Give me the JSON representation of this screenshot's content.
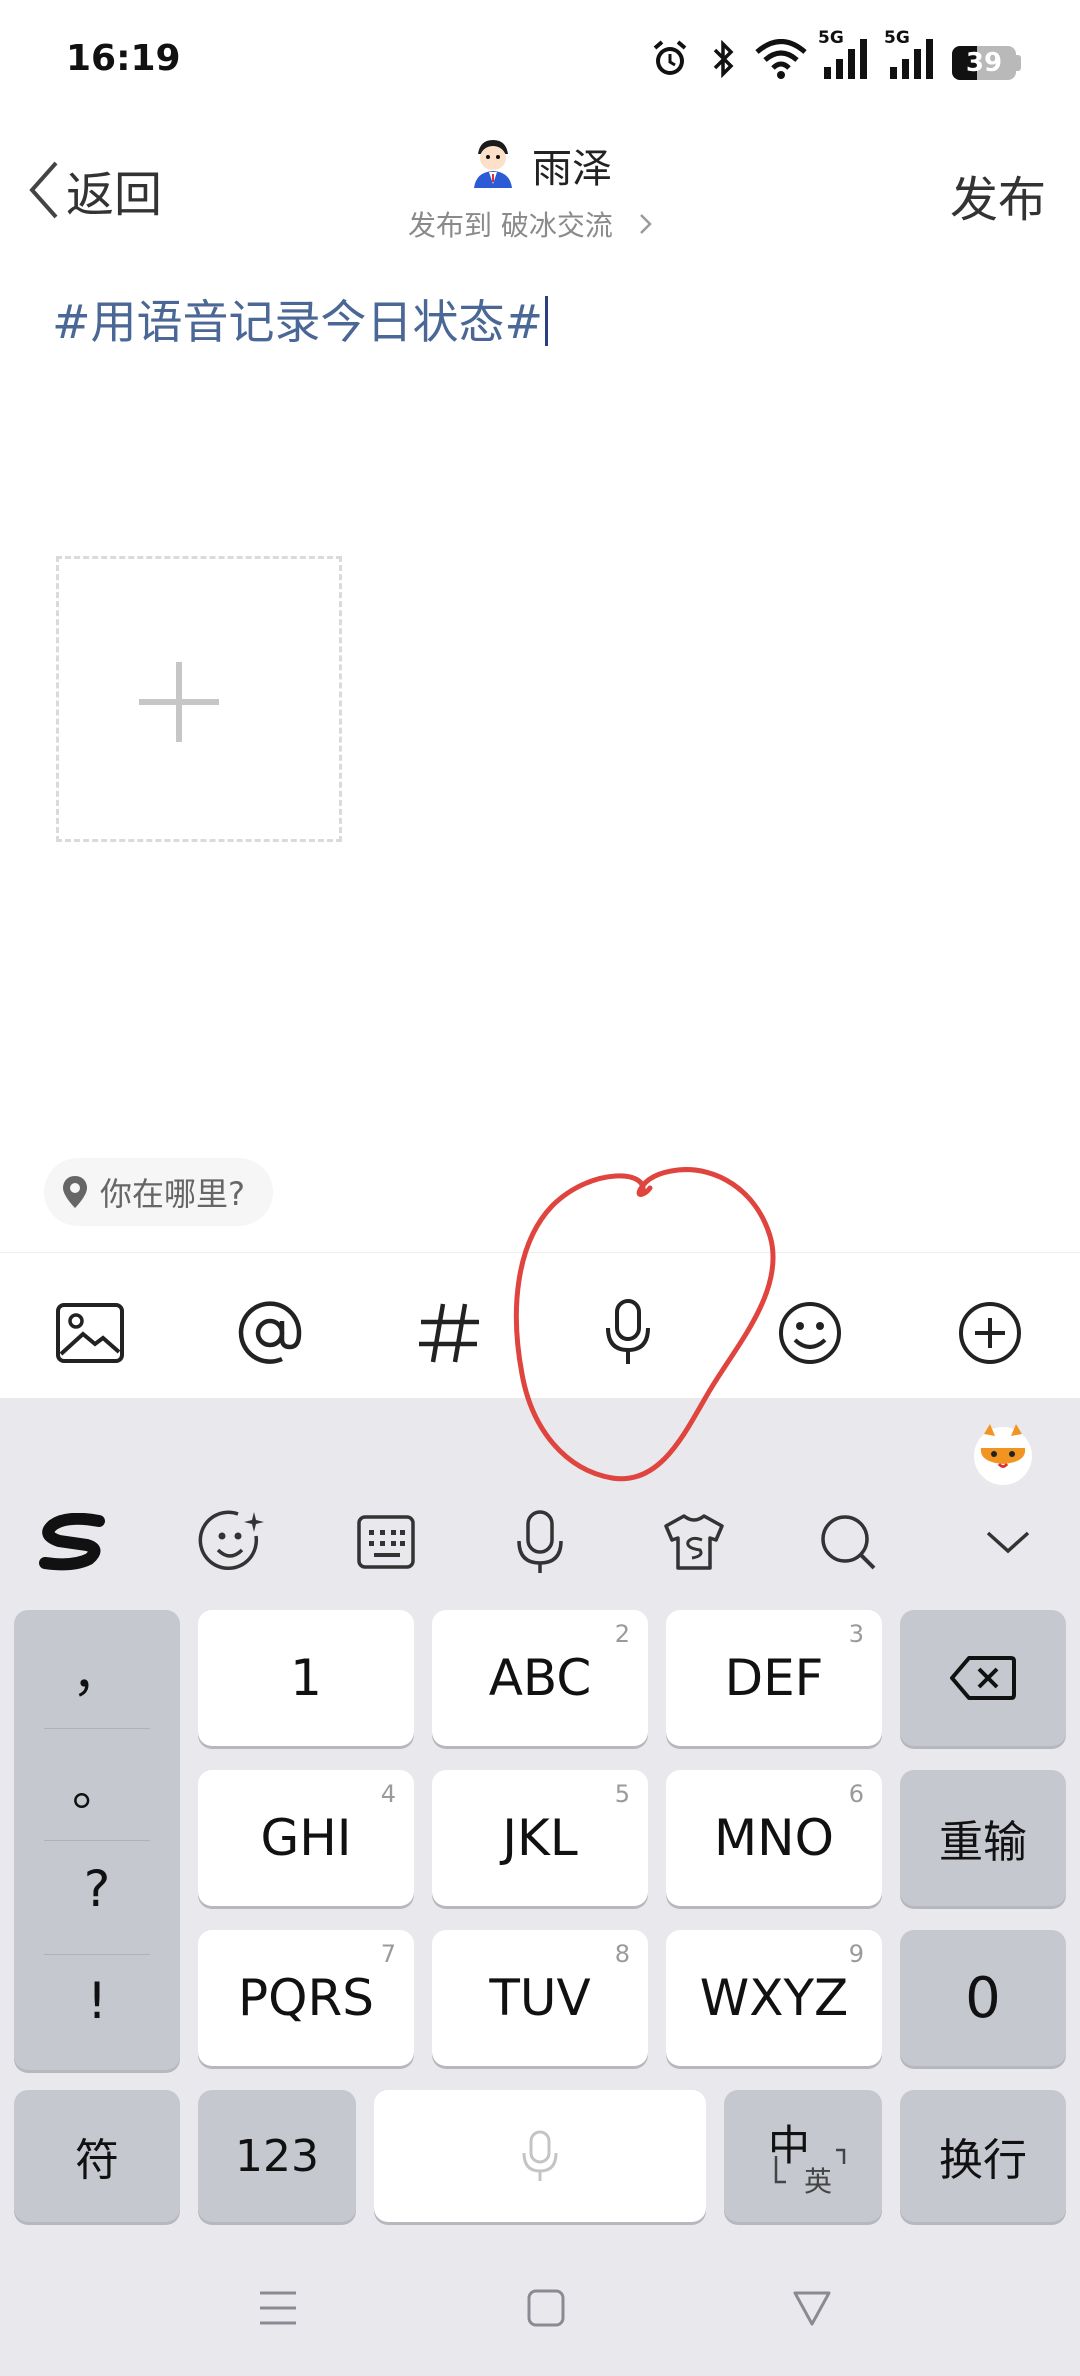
{
  "status_bar": {
    "time": "16:19",
    "network1": "5G",
    "network2": "5G",
    "battery_text": "39",
    "battery_level": 0.39,
    "icons": [
      "alarm-icon",
      "bluetooth-icon",
      "wifi-icon",
      "signal-icon",
      "signal-icon",
      "battery-icon"
    ]
  },
  "header": {
    "back_label": "返回",
    "username": "雨泽",
    "publish_target": "发布到 破冰交流",
    "publish_label": "发布"
  },
  "compose": {
    "text": "#用语音记录今日状态#"
  },
  "location": {
    "placeholder": "你在哪里?"
  },
  "toolbar": {
    "items": [
      "image-icon",
      "at-icon",
      "hashtag-icon",
      "microphone-icon",
      "emoji-icon",
      "add-icon"
    ],
    "highlight_color": "#e0443e"
  },
  "keyboard": {
    "top_bar": [
      "sogou-logo-icon",
      "emoji-icon",
      "keyboard-icon",
      "microphone-icon",
      "skin-icon",
      "search-icon",
      "collapse-icon"
    ],
    "punctuation": [
      "，",
      "。",
      "?",
      "!"
    ],
    "rows": [
      [
        {
          "label": "1",
          "sub": ""
        },
        {
          "label": "ABC",
          "sub": "2"
        },
        {
          "label": "DEF",
          "sub": "3"
        }
      ],
      [
        {
          "label": "GHI",
          "sub": "4"
        },
        {
          "label": "JKL",
          "sub": "5"
        },
        {
          "label": "MNO",
          "sub": "6"
        }
      ],
      [
        {
          "label": "PQRS",
          "sub": "7"
        },
        {
          "label": "TUV",
          "sub": "8"
        },
        {
          "label": "WXYZ",
          "sub": "9"
        }
      ]
    ],
    "reinput_label": "重输",
    "zero_label": "0",
    "symbol_label": "符",
    "num_label": "123",
    "lang_main": "中",
    "lang_sub": "英",
    "enter_label": "换行"
  },
  "nav_bar": [
    "menu-icon",
    "home-icon",
    "back-icon"
  ]
}
